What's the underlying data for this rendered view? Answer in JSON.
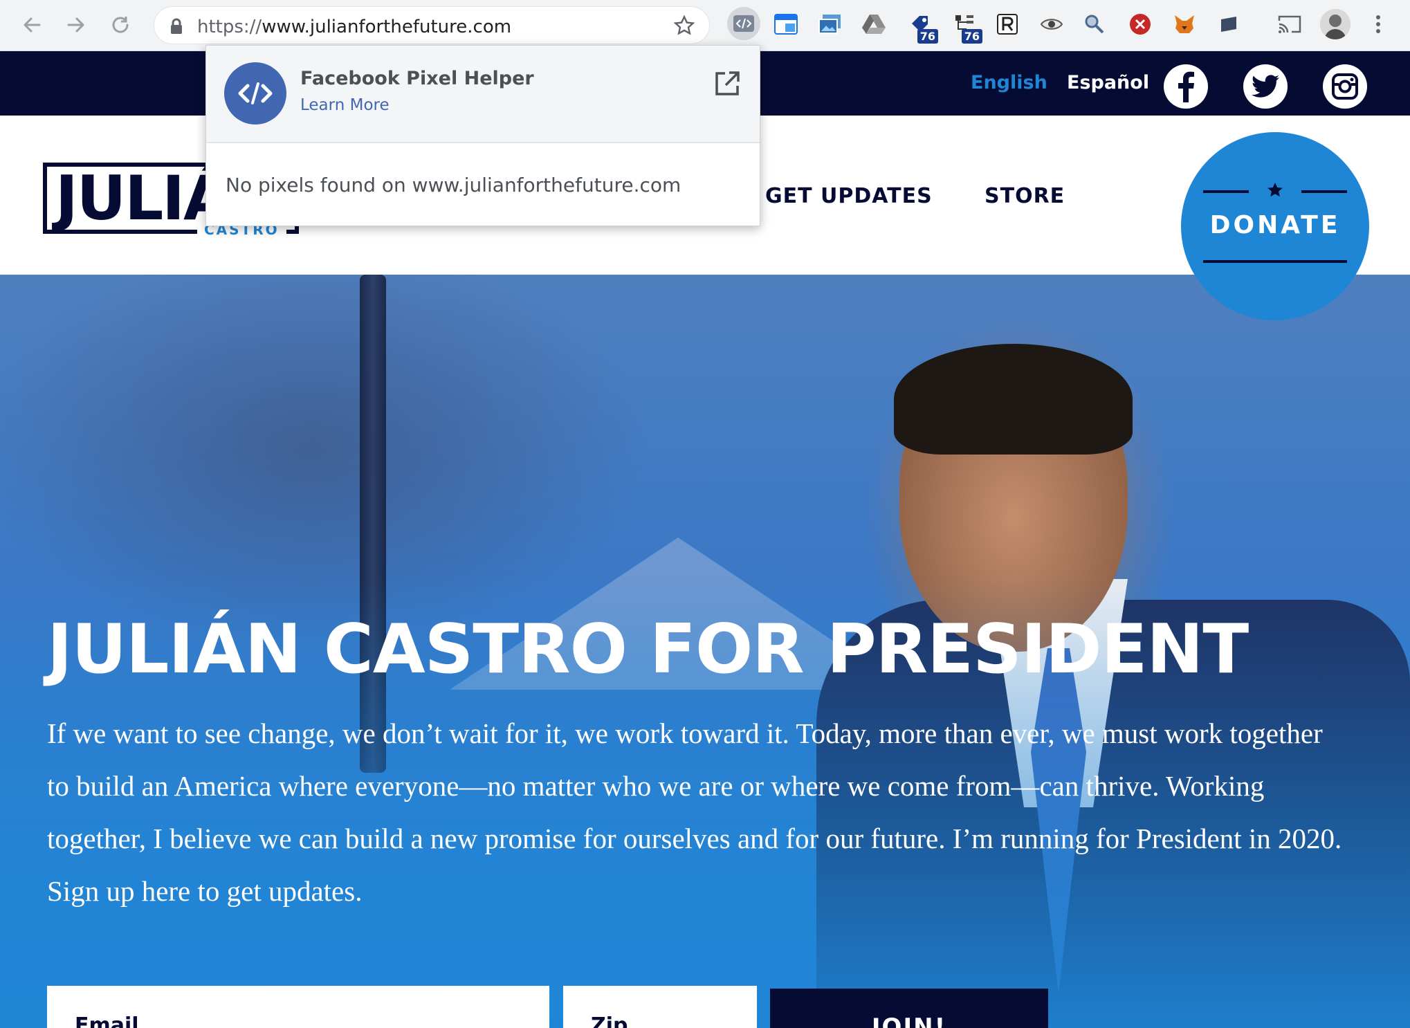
{
  "browser": {
    "url_scheme": "https://",
    "url_host": "www.julianforthefuture.com",
    "extension_badges": [
      "76",
      "76"
    ]
  },
  "topbar": {
    "lang_english": "English",
    "lang_spanish": "Español",
    "colors": {
      "bar": "#060b34",
      "active_lang": "#1f86d6"
    }
  },
  "header": {
    "logo_text": "JULIÁN",
    "logo_sub": "CASTRO",
    "nav": [
      "GET UPDATES",
      "STORE"
    ],
    "donate_label": "DONATE"
  },
  "hero": {
    "title": "JULIÁN CASTRO FOR PRESIDENT",
    "body": "If we want to see change, we don’t wait for it, we work toward it. Today, more than ever, we must work together to build an America where everyone—no matter who we are or where we come from—can thrive. Working together, I believe we can build a new promise for ourselves and for our future. I’m running for President in 2020. Sign up here to get updates.",
    "email_label": "Email",
    "zip_label": "Zip",
    "join_label": "JOIN!"
  },
  "popup": {
    "title": "Facebook Pixel Helper",
    "link": "Learn More",
    "message": "No pixels found on www.julianforthefuture.com"
  }
}
